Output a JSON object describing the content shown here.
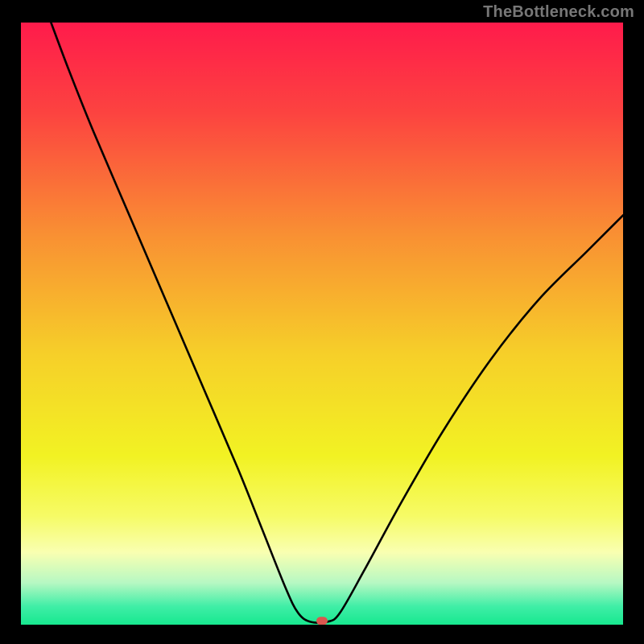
{
  "watermark": "TheBottleneck.com",
  "chart_data": {
    "type": "line",
    "title": "",
    "xlabel": "",
    "ylabel": "",
    "xlim": [
      0,
      100
    ],
    "ylim": [
      0,
      100
    ],
    "background": {
      "type": "vertical-gradient",
      "stops": [
        {
          "pos": 0.0,
          "color": "#ff1b4b"
        },
        {
          "pos": 0.15,
          "color": "#fc4340"
        },
        {
          "pos": 0.35,
          "color": "#f98f33"
        },
        {
          "pos": 0.55,
          "color": "#f6cf29"
        },
        {
          "pos": 0.72,
          "color": "#f2f223"
        },
        {
          "pos": 0.82,
          "color": "#f6fb66"
        },
        {
          "pos": 0.88,
          "color": "#f9ffb1"
        },
        {
          "pos": 0.93,
          "color": "#b7f8c3"
        },
        {
          "pos": 0.97,
          "color": "#3feea6"
        },
        {
          "pos": 1.0,
          "color": "#17e88f"
        }
      ]
    },
    "series": [
      {
        "name": "curve",
        "color": "#000000",
        "points": [
          {
            "x": 5,
            "y": 100
          },
          {
            "x": 8,
            "y": 92
          },
          {
            "x": 12,
            "y": 82
          },
          {
            "x": 18,
            "y": 68
          },
          {
            "x": 24,
            "y": 54
          },
          {
            "x": 30,
            "y": 40
          },
          {
            "x": 36,
            "y": 26
          },
          {
            "x": 40,
            "y": 16
          },
          {
            "x": 44,
            "y": 6
          },
          {
            "x": 46,
            "y": 2
          },
          {
            "x": 48,
            "y": 0.5
          },
          {
            "x": 51,
            "y": 0.5
          },
          {
            "x": 53,
            "y": 2
          },
          {
            "x": 57,
            "y": 9
          },
          {
            "x": 63,
            "y": 20
          },
          {
            "x": 70,
            "y": 32
          },
          {
            "x": 78,
            "y": 44
          },
          {
            "x": 86,
            "y": 54
          },
          {
            "x": 94,
            "y": 62
          },
          {
            "x": 100,
            "y": 68
          }
        ]
      }
    ],
    "marker": {
      "x": 50,
      "y": 0.5,
      "color": "#d9574f",
      "label": ""
    }
  }
}
